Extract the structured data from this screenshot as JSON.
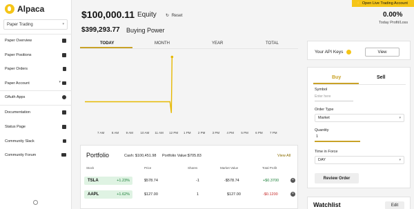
{
  "brand": {
    "name": "Alpaca"
  },
  "account_select": {
    "value": "Paper Trading"
  },
  "sidebar": {
    "items": [
      {
        "label": "Paper Overview",
        "icon": "home-icon"
      },
      {
        "label": "Paper Positions",
        "icon": "briefcase-icon"
      },
      {
        "label": "Paper Orders",
        "icon": "document-icon"
      },
      {
        "label": "Paper Account",
        "icon": "card-icon"
      },
      {
        "label": "OAuth Apps",
        "icon": "link-icon"
      },
      {
        "label": "Documentation",
        "icon": "book-icon"
      },
      {
        "label": "Status Page",
        "icon": "monitor-icon"
      },
      {
        "label": "Community Slack",
        "icon": "slack-icon"
      },
      {
        "label": "Community Forum",
        "icon": "people-icon"
      }
    ]
  },
  "cta": {
    "label": "Open Live Trading Account"
  },
  "summary": {
    "equity_value": "$100,000.11",
    "equity_label": "Equity",
    "reset_label": "Reset",
    "buying_power_value": "$399,293.77",
    "buying_power_label": "Buying Power",
    "pl_value": "0.00%",
    "pl_label": "Today Profit/Loss"
  },
  "range_tabs": [
    {
      "label": "TODAY",
      "active": true
    },
    {
      "label": "MONTH",
      "active": false
    },
    {
      "label": "YEAR",
      "active": false
    },
    {
      "label": "TOTAL",
      "active": false
    }
  ],
  "chart_data": {
    "type": "line",
    "x": [
      "7 AM",
      "8 AM",
      "9 AM",
      "10 AM",
      "11 AM",
      "12 PM",
      "1 PM",
      "2 PM",
      "3 PM",
      "4 PM",
      "5 PM",
      "6 PM",
      "7 PM"
    ],
    "series": [
      {
        "values": [
          100000,
          100000,
          100000,
          100000,
          100000,
          100000,
          95000,
          120000
        ]
      }
    ],
    "color": "#e6b800"
  },
  "portfolio": {
    "title": "Portfolio",
    "cash": "Cash: $100,451.98",
    "value": "Portfolio Value:$705.83",
    "view_all": "View All",
    "headers": [
      "Stock",
      "Price",
      "Shares",
      "Market Value",
      "Total Profit"
    ],
    "rows": [
      {
        "symbol": "TSLA",
        "change": "+1.23%",
        "price": "$578.74",
        "shares": "-1",
        "market_value": "-$578.74",
        "profit": "+$0.3700",
        "profit_positive": true
      },
      {
        "symbol": "AAPL",
        "change": "+1.62%",
        "price": "$127.00",
        "shares": "1",
        "market_value": "$127.00",
        "profit": "-$0.1200",
        "profit_positive": false
      }
    ]
  },
  "api_keys": {
    "label": "Your API Keys",
    "view_button": "View"
  },
  "trade": {
    "buy_tab": "Buy",
    "sell_tab": "Sell",
    "symbol_label": "Symbol",
    "symbol_placeholder": "Enter here",
    "order_type_label": "Order Type",
    "order_type_value": "Market",
    "quantity_label": "Quantity",
    "quantity_value": "1",
    "tif_label": "Time in Force",
    "tif_value": "DAY",
    "review_button": "Review Order"
  },
  "watchlist": {
    "title": "Watchlist",
    "edit_button": "Edit"
  }
}
